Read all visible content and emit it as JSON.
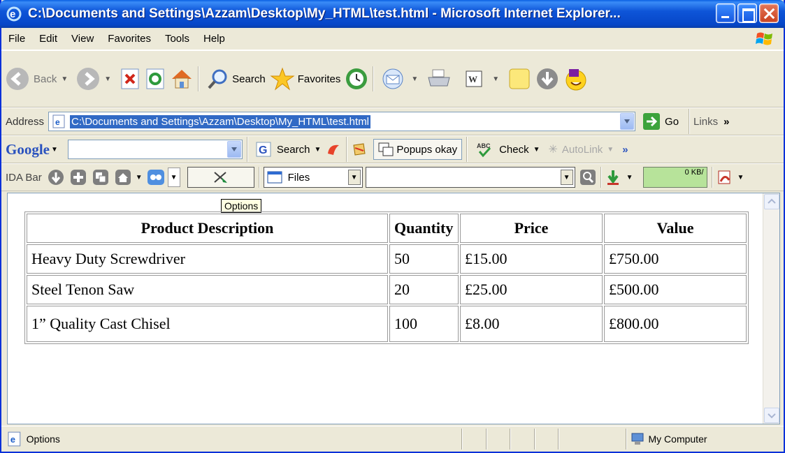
{
  "window": {
    "title": "C:\\Documents and Settings\\Azzam\\Desktop\\My_HTML\\test.html - Microsoft Internet Explorer..."
  },
  "menu": [
    "File",
    "Edit",
    "View",
    "Favorites",
    "Tools",
    "Help"
  ],
  "toolbar": {
    "back_label": "Back",
    "search_label": "Search",
    "favorites_label": "Favorites"
  },
  "address": {
    "label": "Address",
    "url": "C:\\Documents and Settings\\Azzam\\Desktop\\My_HTML\\test.html",
    "go_label": "Go",
    "links_label": "Links",
    "links_more": "»"
  },
  "google": {
    "logo": "Google",
    "search_label": "Search",
    "popups_label": "Popups okay",
    "check_label": "Check",
    "autolink_label": "AutoLink",
    "more": "»"
  },
  "ida": {
    "label": "IDA Bar",
    "files_label": "Files",
    "speed_value": "0 KB/"
  },
  "tooltip": "Options",
  "table": {
    "headers": [
      "Product Description",
      "Quantity",
      "Price",
      "Value"
    ],
    "rows": [
      [
        "Heavy Duty Screwdriver",
        "50",
        "£15.00",
        "£750.00"
      ],
      [
        "Steel Tenon Saw",
        "20",
        "£25.00",
        "£500.00"
      ],
      [
        "1” Quality Cast Chisel",
        "100",
        "£8.00",
        "£800.00"
      ]
    ]
  },
  "status": {
    "text": "Options",
    "zone": "My Computer"
  },
  "colors": {
    "titlebar": "#0A5FE3",
    "selection": "#316AC5",
    "chrome": "#ECE9D8"
  }
}
